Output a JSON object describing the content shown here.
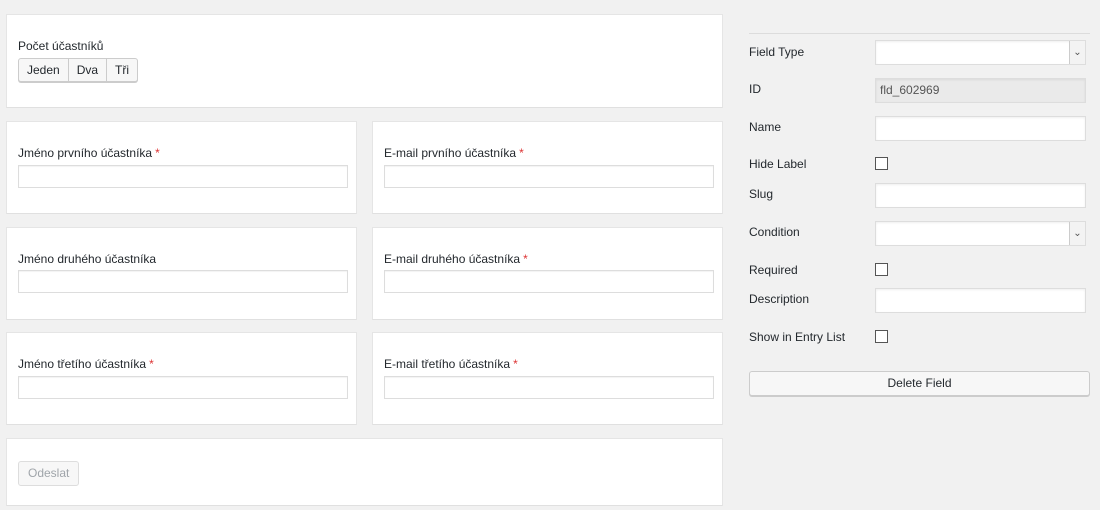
{
  "form": {
    "count_label": "Počet účastníků",
    "count_options": [
      "Jeden",
      "Dva",
      "Tři"
    ],
    "first_name": "Jméno prvního účastníka",
    "first_email": "E-mail prvního účastníka",
    "second_name": "Jméno druhého účastníka",
    "second_email": "E-mail druhého účastníka",
    "third_name": "Jméno třetího účastníka",
    "third_email": "E-mail třetího účastníka",
    "required_mark": "*",
    "submit": "Odeslat"
  },
  "panel": {
    "field_type_label": "Field Type",
    "field_type_value": "",
    "id_label": "ID",
    "id_value": "fld_602969",
    "name_label": "Name",
    "hide_label_label": "Hide Label",
    "slug_label": "Slug",
    "condition_label": "Condition",
    "required_label": "Required",
    "description_label": "Description",
    "show_in_entry_list_label": "Show in Entry List",
    "delete_button": "Delete Field"
  },
  "icons": {
    "select_arrow": "chevron-down-icon"
  },
  "colors": {
    "required": "#dd3333",
    "background": "#f1f1f1"
  }
}
